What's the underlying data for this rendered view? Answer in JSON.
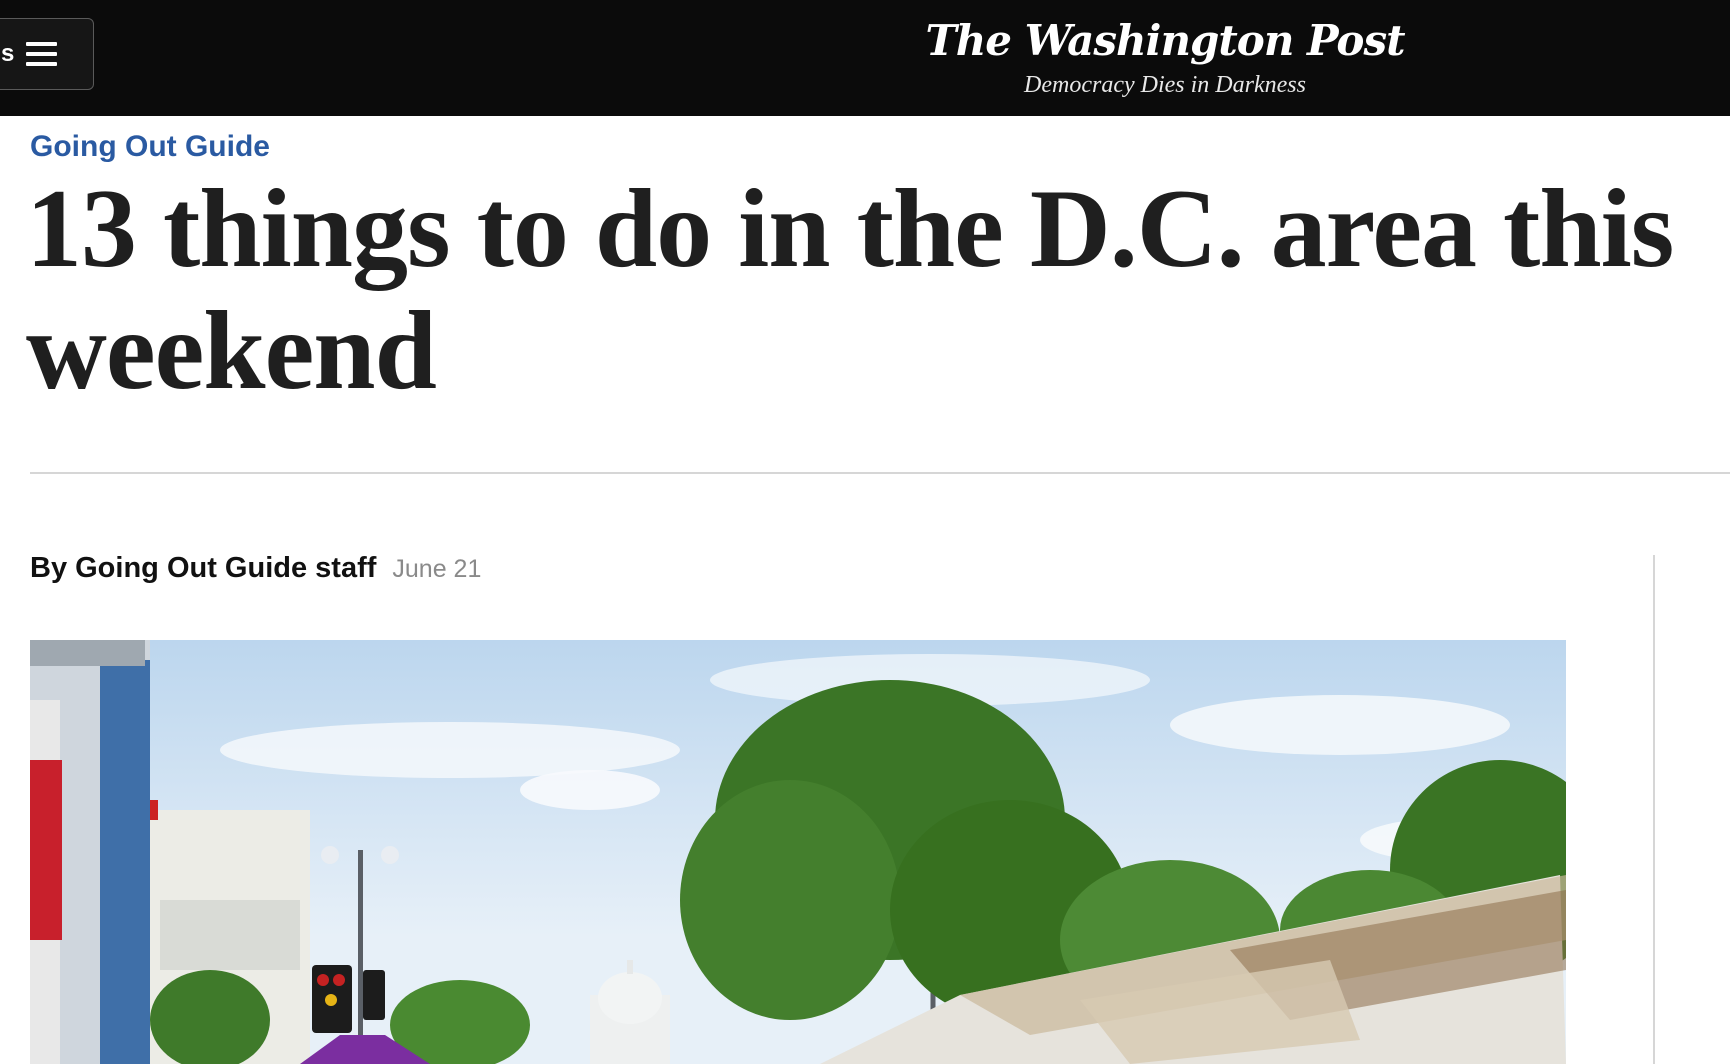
{
  "header": {
    "menu_label": "s",
    "logo_text": "The Washington Post",
    "tagline": "Democracy Dies in Darkness",
    "background": "#0b0b0b"
  },
  "article": {
    "kicker": "Going Out Guide",
    "kicker_color": "#2a5aa2",
    "headline": "13 things to do in the D.C. area this weekend",
    "byline": "By Going Out Guide staff",
    "date": "June 21"
  },
  "photo": {
    "icon": "street-festival-photo",
    "description_hidden": false
  }
}
